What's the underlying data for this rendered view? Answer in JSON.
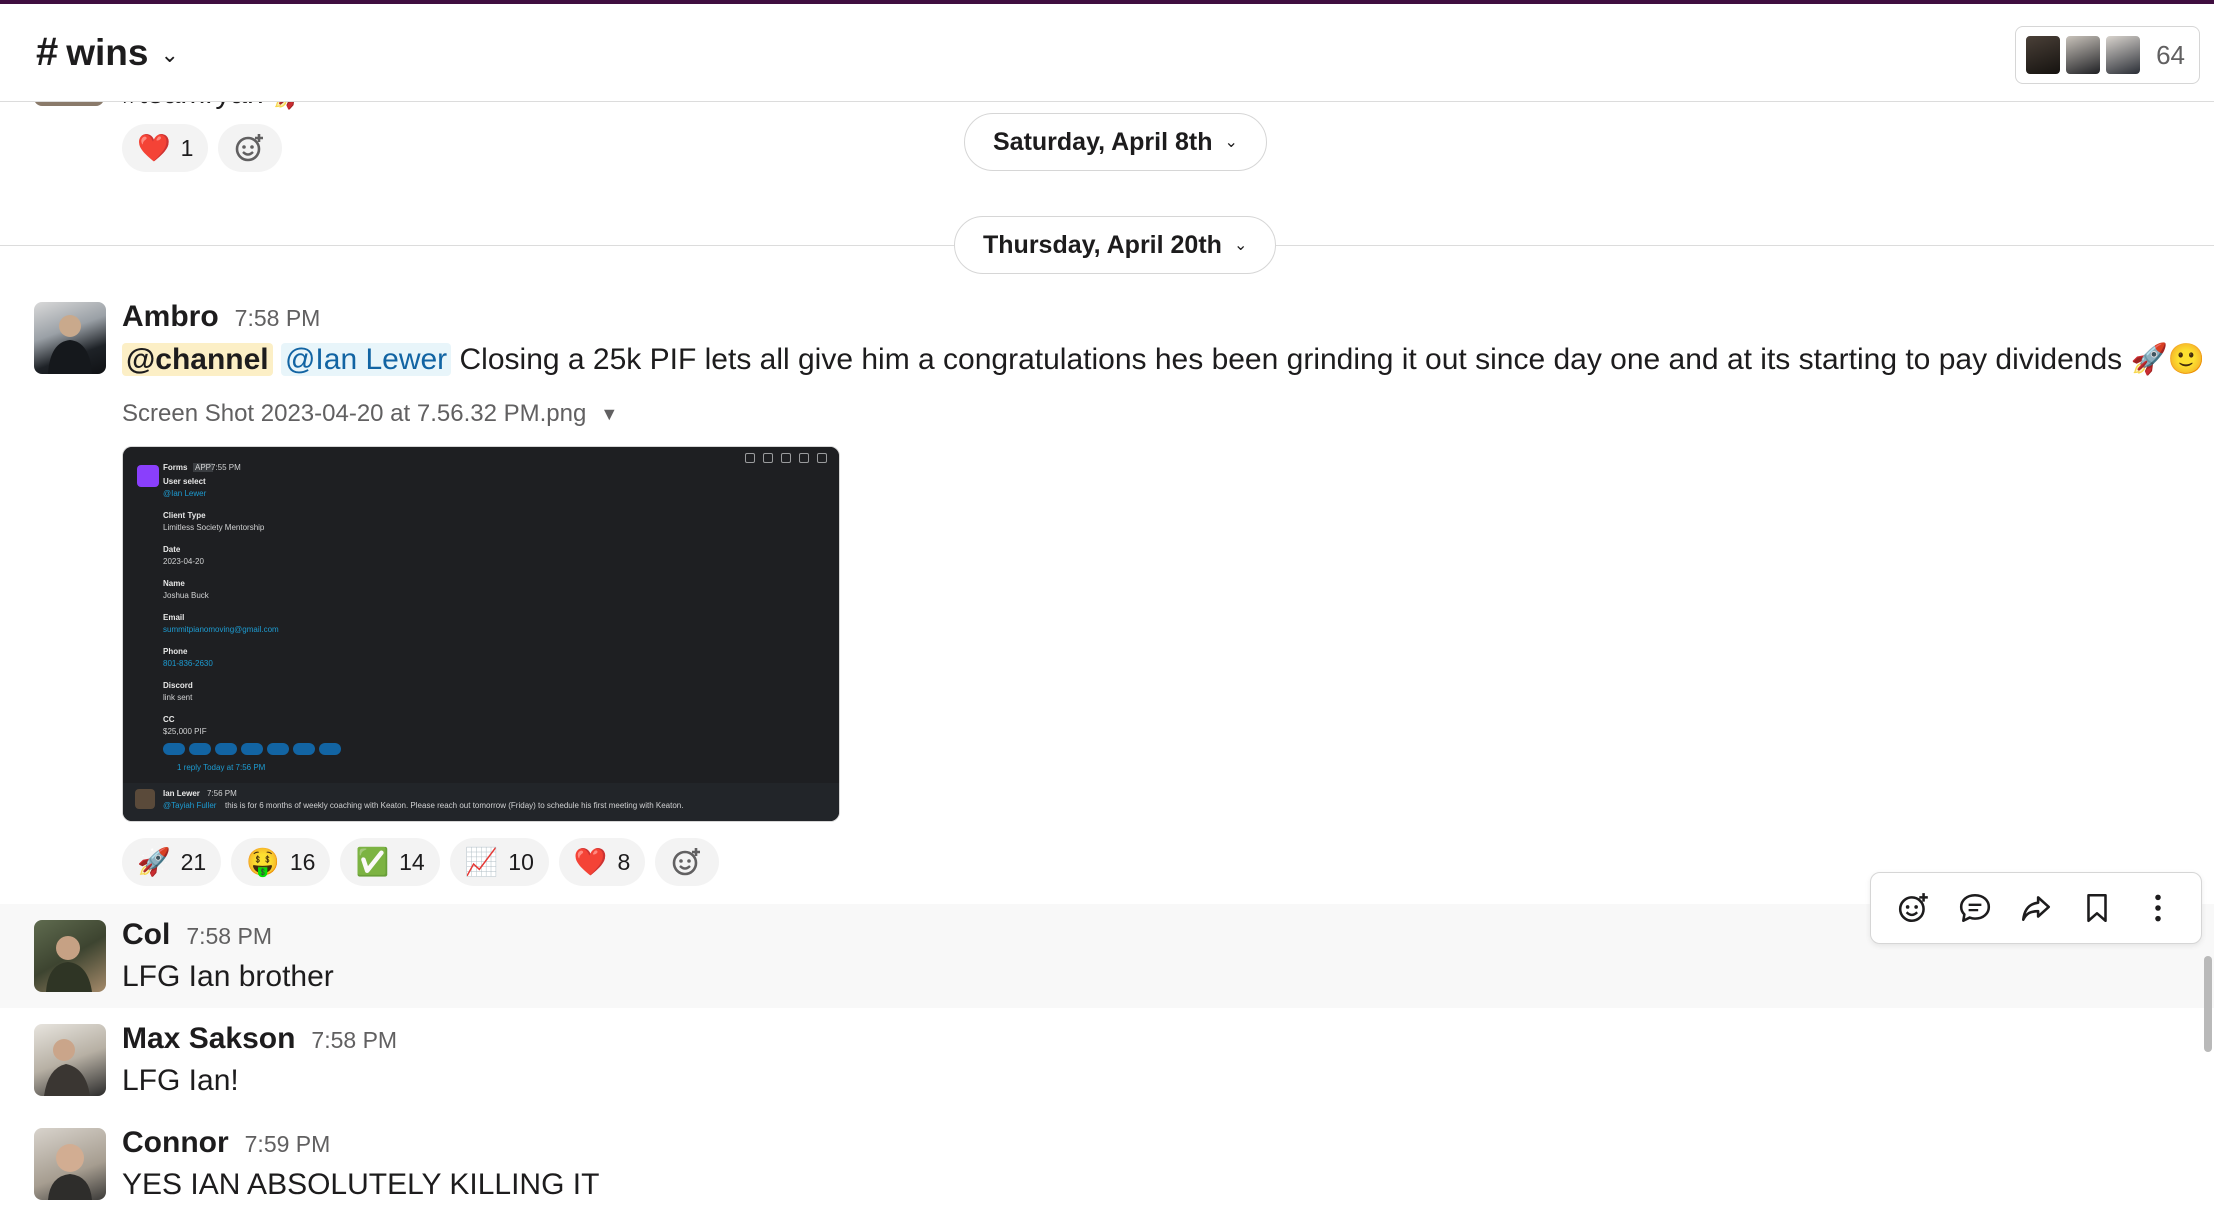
{
  "channel": {
    "hash": "#",
    "name": "wins",
    "member_count": "64"
  },
  "previous_message": {
    "text_fragment": "#teamryan 🚀",
    "reactions": [
      {
        "emoji": "❤️",
        "count": "1"
      }
    ]
  },
  "dividers": [
    {
      "label": "Saturday, April 8th"
    },
    {
      "label": "Thursday, April 20th"
    }
  ],
  "messages": [
    {
      "author": "Ambro",
      "time": "7:58 PM",
      "mention_channel": "@channel",
      "mention_user": "@Ian Lewer",
      "text": "Closing a 25k PIF lets all give him a congratulations hes been grinding it out since day one and at its starting to pay dividends 🚀🙂",
      "file_name": "Screen Shot 2023-04-20 at 7.56.32 PM.png",
      "attachment": {
        "app_name": "Forms",
        "app_badge": "APP",
        "app_time": "7:55 PM",
        "fields": [
          {
            "label": "User select",
            "value": "@Ian Lewer"
          },
          {
            "label": "Client Type",
            "value": "Limitless Society Mentorship"
          },
          {
            "label": "Date",
            "value": "2023-04-20"
          },
          {
            "label": "Name",
            "value": "Joshua Buck"
          },
          {
            "label": "Email",
            "value": "summitpianomoving@gmail.com"
          },
          {
            "label": "Phone",
            "value": "801-836-2630"
          },
          {
            "label": "Discord",
            "value": "link sent"
          },
          {
            "label": "CC",
            "value": "$25,000 PIF"
          }
        ],
        "reply_info": "1 reply  Today at 7:56 PM",
        "reply_author": "Ian Lewer",
        "reply_time": "7:56 PM",
        "reply_mention": "@Tayiah Fuller",
        "reply_text": "this is for 6 months of weekly coaching with Keaton.   Please reach out tomorrow (Friday) to schedule his first meeting with Keaton."
      },
      "reactions": [
        {
          "emoji": "🚀",
          "count": "21"
        },
        {
          "emoji": "🤑",
          "count": "16"
        },
        {
          "emoji": "✅",
          "count": "14"
        },
        {
          "emoji": "📈",
          "count": "10"
        },
        {
          "emoji": "❤️",
          "count": "8"
        }
      ]
    },
    {
      "author": "Col",
      "time": "7:58 PM",
      "text": "LFG Ian brother"
    },
    {
      "author": "Max Sakson",
      "time": "7:58 PM",
      "text": "LFG Ian!"
    },
    {
      "author": "Connor",
      "time": "7:59 PM",
      "text": "YES IAN ABSOLUTELY KILLING IT"
    }
  ],
  "toolbar": {
    "icons": [
      "add-reaction-icon",
      "reply-thread-icon",
      "share-icon",
      "bookmark-icon",
      "more-actions-icon"
    ]
  },
  "colors": {
    "accent_top": "#3f0e40",
    "mention_channel_bg": "#fcefc6",
    "mention_user_bg": "#e8f5fa",
    "mention_user_text": "#1264a3",
    "reaction_bg": "#f3f3f3"
  }
}
